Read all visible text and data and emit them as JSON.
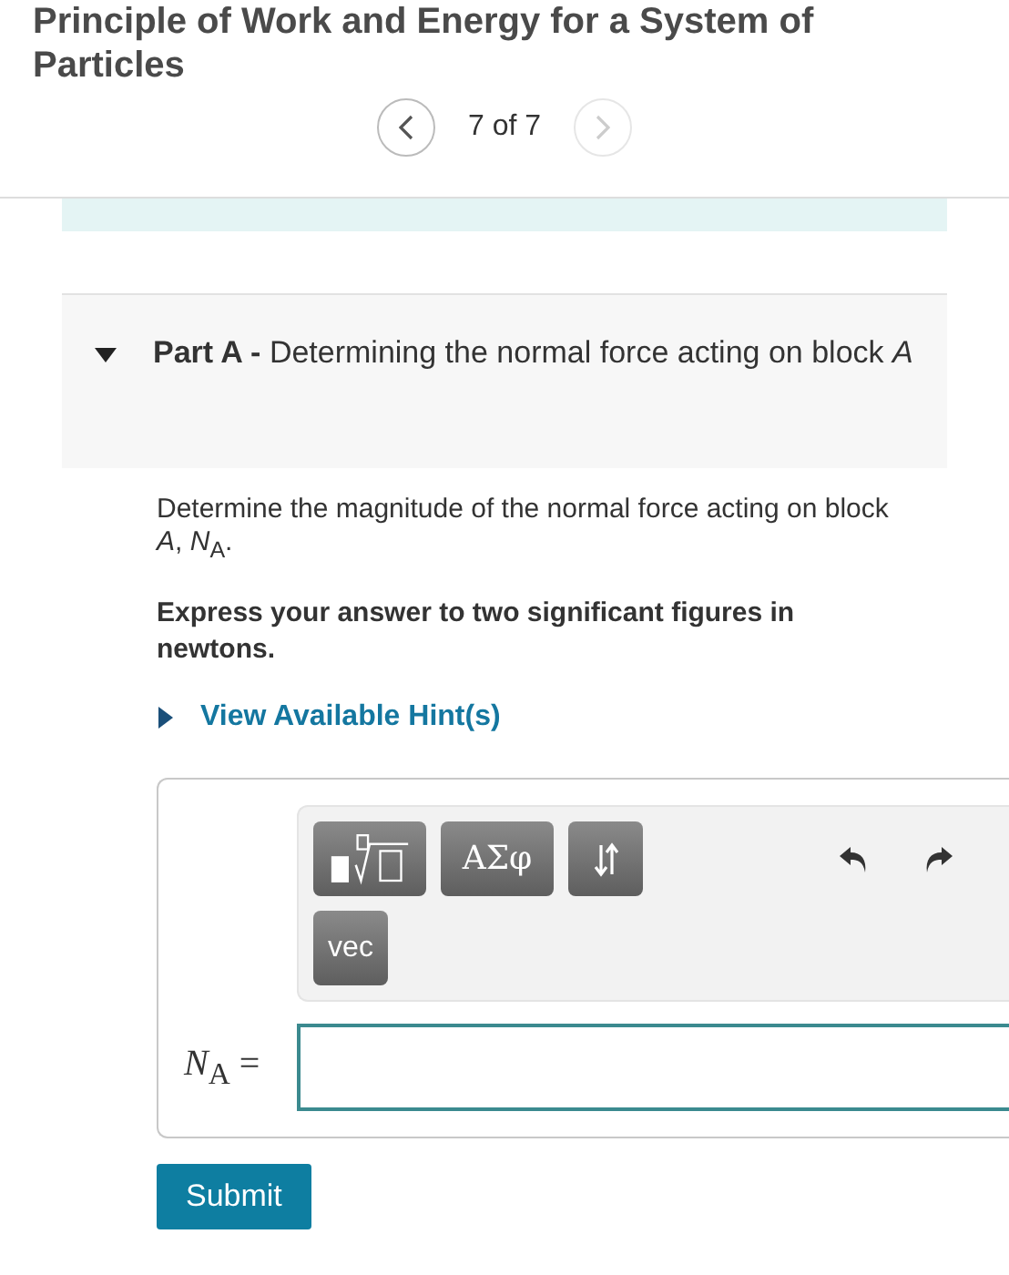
{
  "header": {
    "title": "Principle of Work and Energy for a System of Particles",
    "position": "7 of 7",
    "next_disabled": true
  },
  "part": {
    "expanded": true,
    "label": "Part A -",
    "title": "Determining the normal force acting on block *A*"
  },
  "question": "Determine the magnitude of the normal force acting on block *A*, *N*$_{A}$.",
  "instruction": "Express your answer to two significant figures in newtons.",
  "hint": {
    "label": "View Available Hint(s)",
    "expanded": false
  },
  "toolbar": [
    {
      "kind": "template"
    },
    {
      "kind": "text",
      "label": "ΑΣφ"
    },
    {
      "kind": "arrows"
    },
    {
      "kind": "text",
      "label": "vec"
    }
  ],
  "answer": {
    "label": "*N*$_{A}$ ="
  },
  "submit": "Submit"
}
